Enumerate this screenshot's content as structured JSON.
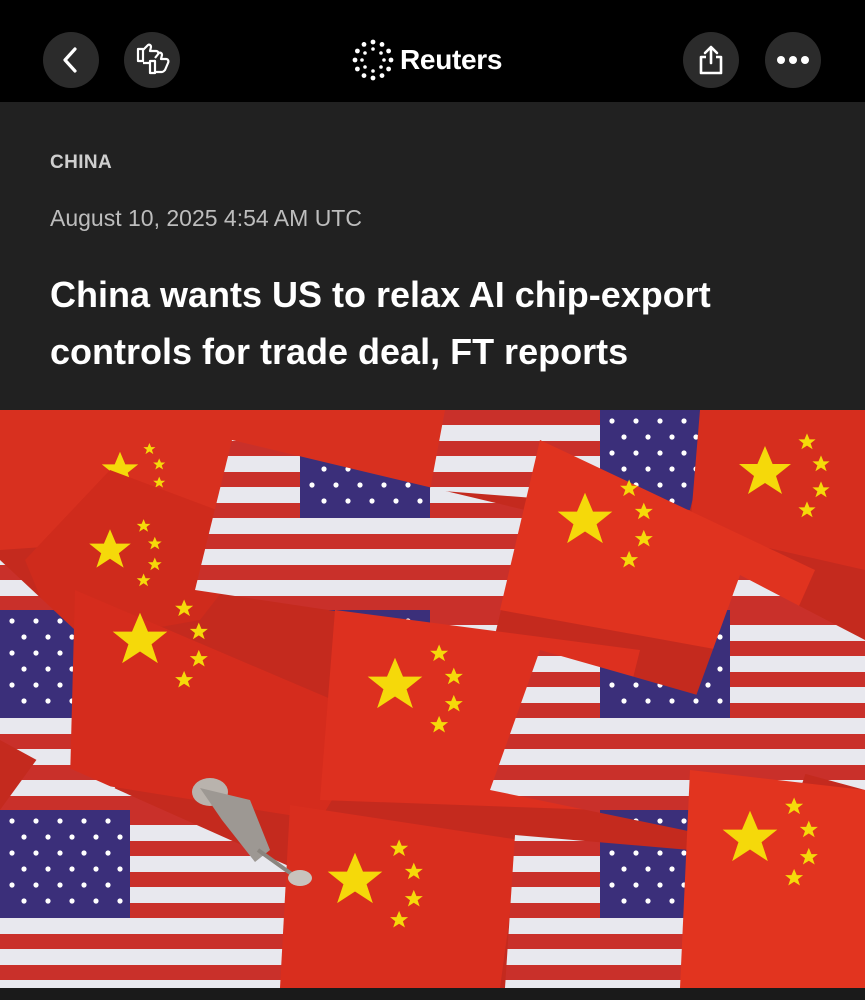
{
  "topbar": {
    "back_icon": "chevron-left-icon",
    "reactions_icon": "thumbs-reactions-icon",
    "brand": "Reuters",
    "brand_icon": "reuters-dot-ring-logo",
    "share_icon": "share-icon",
    "more_icon": "ellipsis-icon"
  },
  "article": {
    "section": "CHINA",
    "timestamp": "August 10, 2025 4:54 AM UTC",
    "headline": "China wants US to relax AI chip-export controls for trade deal, FT reports"
  },
  "colors": {
    "background": "#000000",
    "header_bg": "#212121",
    "button_bg": "#2b2b2b",
    "flag_red": "#d2291c",
    "flag_yellow": "#f5d90a",
    "flag_blue": "#3b2f7a"
  }
}
